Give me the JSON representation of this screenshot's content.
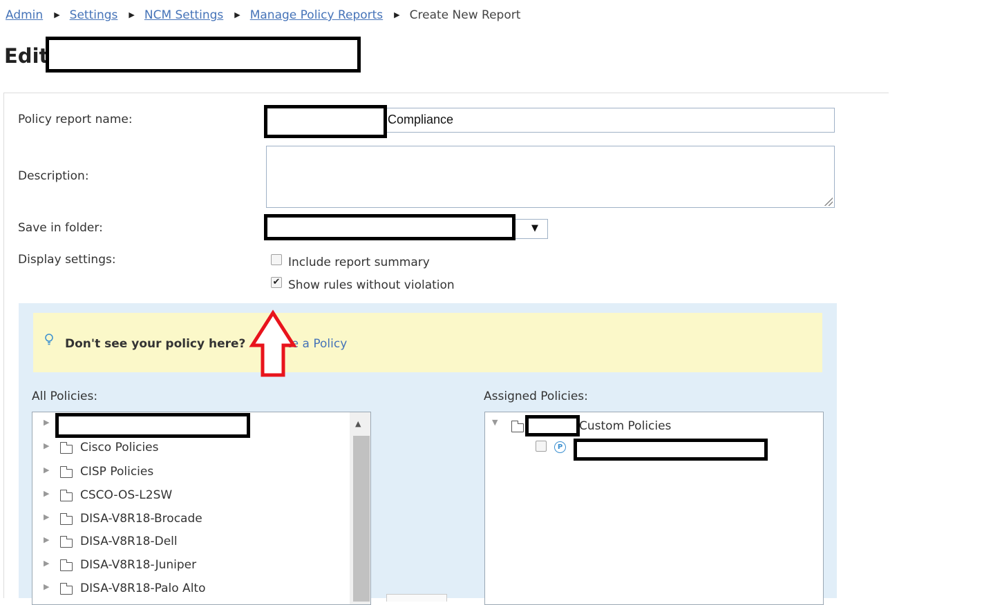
{
  "breadcrumb": {
    "items": [
      "Admin",
      "Settings",
      "NCM Settings",
      "Manage Policy Reports"
    ],
    "current": "Create New Report",
    "separator": "▶"
  },
  "page": {
    "title": "Edit"
  },
  "form": {
    "name_label": "Policy report name:",
    "name_value_visible": "Compliance",
    "description_label": "Description:",
    "description_value": "",
    "folder_label": "Save in folder:",
    "display_label": "Display settings:",
    "display_options": [
      {
        "label": "Include report summary",
        "checked": false
      },
      {
        "label": "Show rules without violation",
        "checked": true
      }
    ]
  },
  "policies": {
    "hint_text": "Don't see your policy here?",
    "hint_link": "te a Policy",
    "all_label": "All Policies:",
    "assigned_label": "Assigned Policies:",
    "all_items": [
      "Cisco Policies",
      "CISP Policies",
      "CSCO-OS-L2SW",
      "DISA-V8R18-Brocade",
      "DISA-V8R18-Dell",
      "DISA-V8R18-Juniper",
      "DISA-V8R18-Palo Alto"
    ],
    "assigned_group": "Custom Policies",
    "policy_icon_letter": "P"
  },
  "icons": {
    "breadcrumb_separator": "triangle-right-icon",
    "hint": "lightbulb-icon",
    "folder": "folder-icon",
    "expand": "triangle-right-icon",
    "collapse": "triangle-down-icon",
    "policy": "policy-p-icon",
    "dropdown": "triangle-down-icon"
  },
  "colors": {
    "link": "#4573b8",
    "panel_bg": "#e1eef8",
    "hint_bg": "#fbf8c9",
    "annotation_arrow": "#e8141c"
  }
}
